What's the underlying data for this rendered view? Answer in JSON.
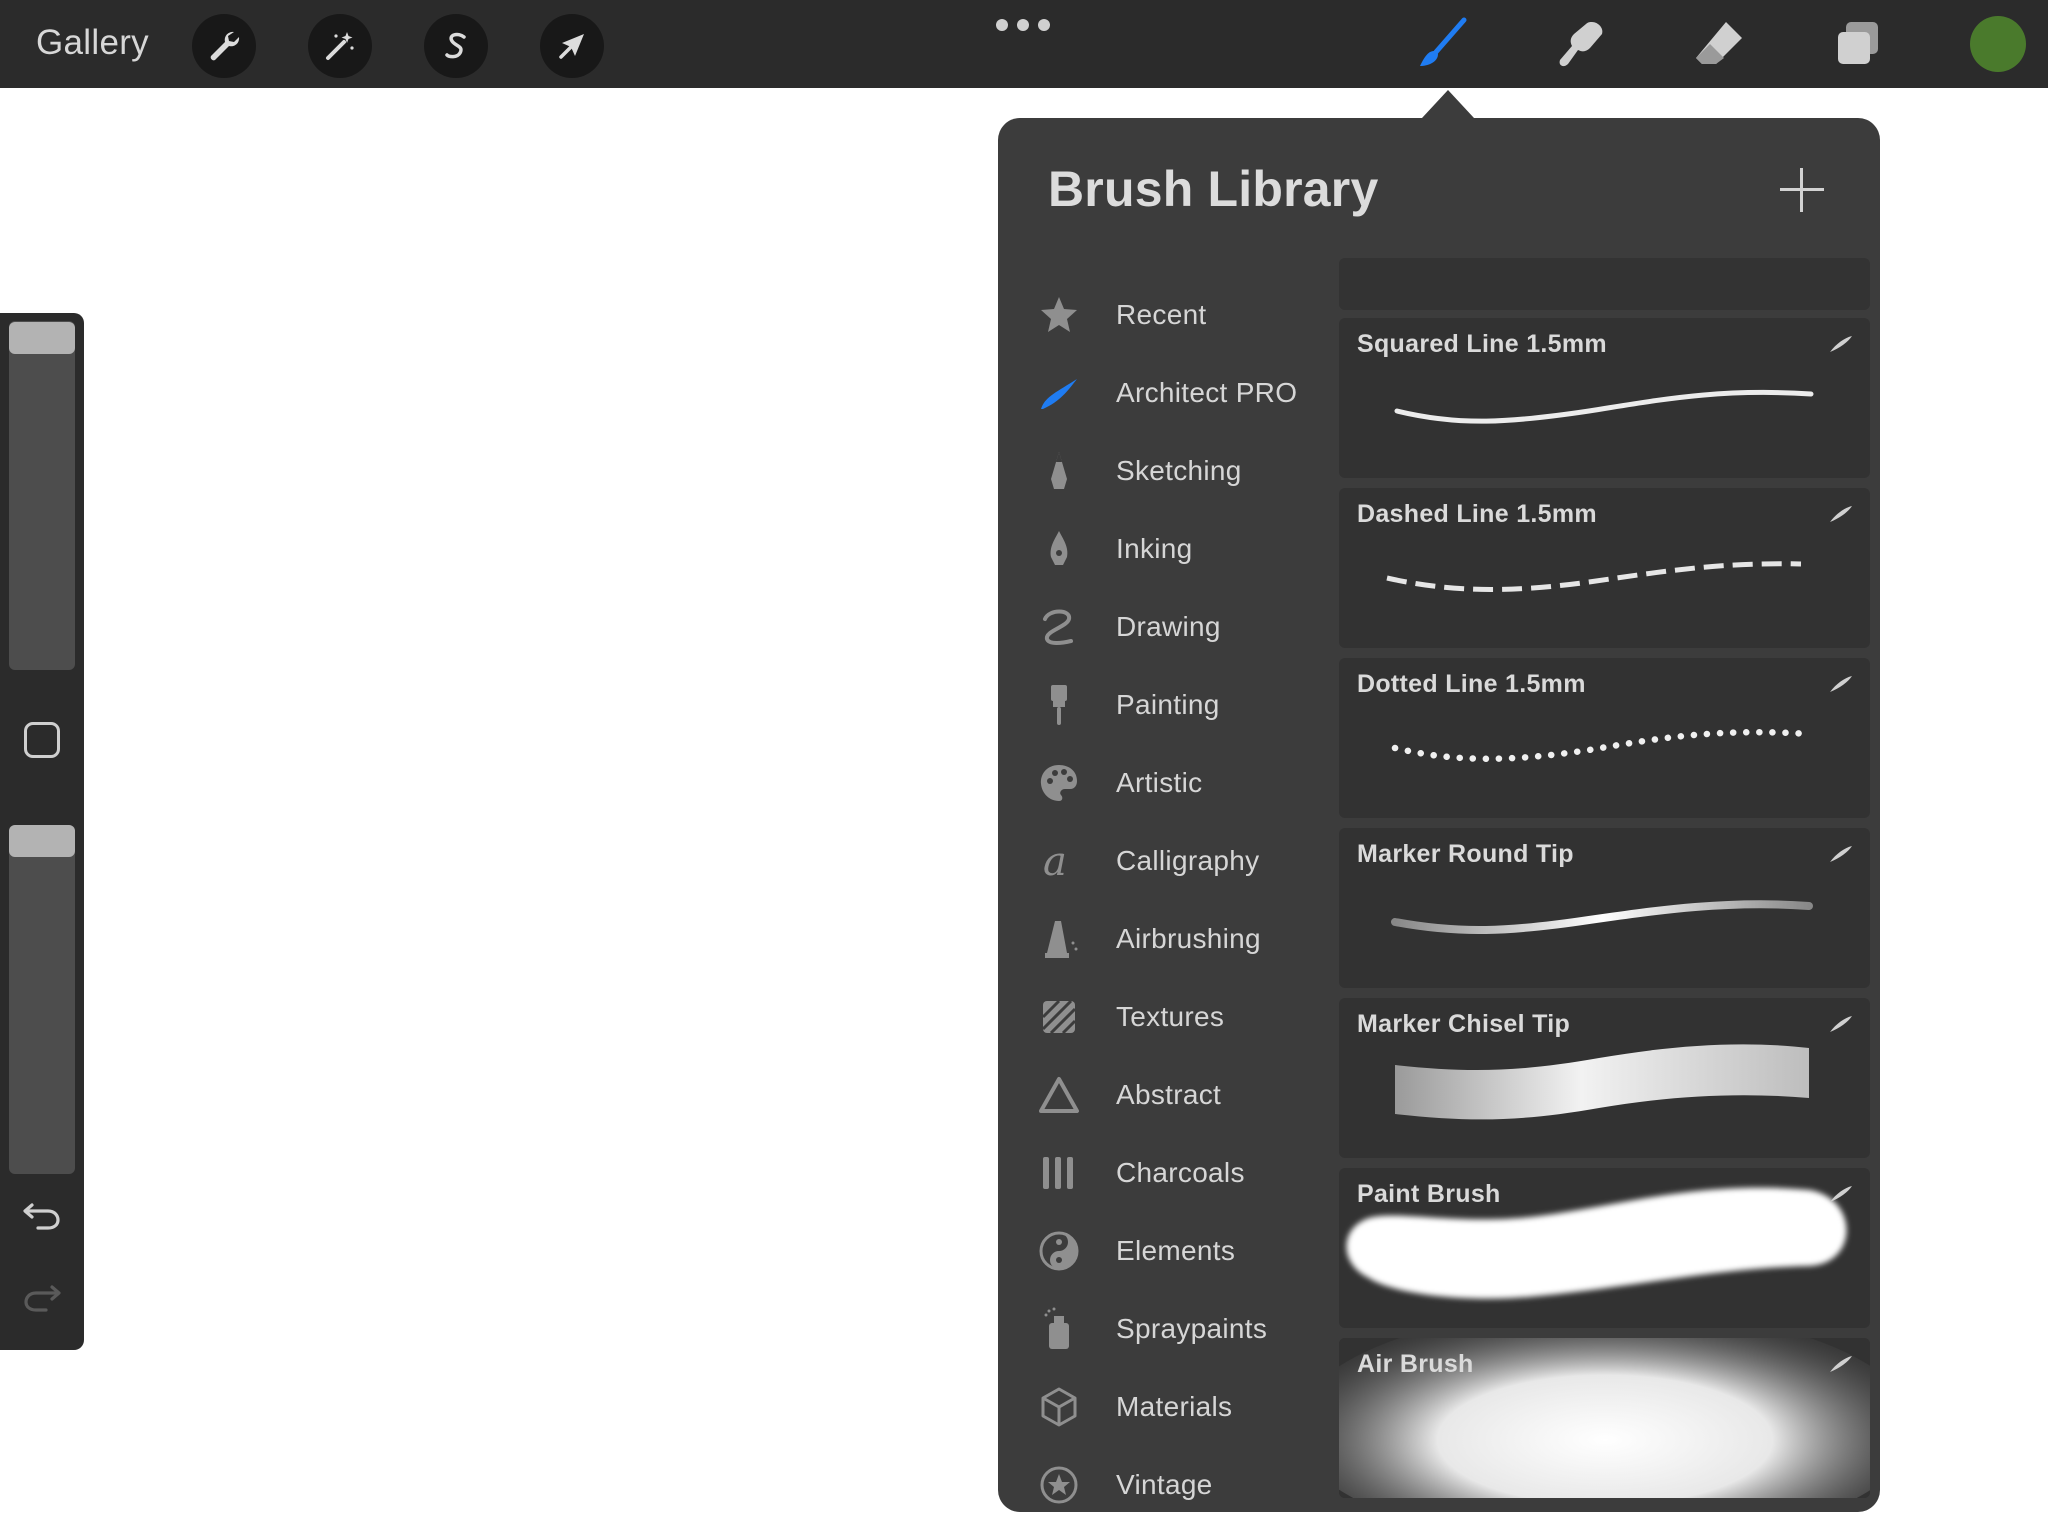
{
  "topbar": {
    "gallery_label": "Gallery",
    "left_tools": [
      {
        "name": "wrench-icon"
      },
      {
        "name": "magic-wand-icon"
      },
      {
        "name": "selection-icon"
      },
      {
        "name": "transform-arrow-icon"
      }
    ],
    "right_tools": [
      {
        "name": "brush-icon",
        "active": true,
        "color": "#1f7cf2"
      },
      {
        "name": "smudge-icon",
        "active": false
      },
      {
        "name": "eraser-icon",
        "active": false
      },
      {
        "name": "layers-icon",
        "active": false
      }
    ],
    "current_color": "#4a7a2c"
  },
  "brush_library": {
    "title": "Brush Library",
    "categories": [
      {
        "label": "Recent",
        "icon": "star-icon"
      },
      {
        "label": "Architect PRO",
        "icon": "brush-stroke-icon",
        "selected": true
      },
      {
        "label": "Sketching",
        "icon": "pencil-tip-icon"
      },
      {
        "label": "Inking",
        "icon": "ink-pen-icon"
      },
      {
        "label": "Drawing",
        "icon": "squiggle-icon"
      },
      {
        "label": "Painting",
        "icon": "paint-brush-icon"
      },
      {
        "label": "Artistic",
        "icon": "palette-icon"
      },
      {
        "label": "Calligraphy",
        "icon": "calligraphy-a-icon"
      },
      {
        "label": "Airbrushing",
        "icon": "airbrush-icon"
      },
      {
        "label": "Textures",
        "icon": "texture-icon"
      },
      {
        "label": "Abstract",
        "icon": "triangle-icon"
      },
      {
        "label": "Charcoals",
        "icon": "charcoal-icon"
      },
      {
        "label": "Elements",
        "icon": "yin-yang-icon"
      },
      {
        "label": "Spraypaints",
        "icon": "spray-can-icon"
      },
      {
        "label": "Materials",
        "icon": "cube-icon"
      },
      {
        "label": "Vintage",
        "icon": "star-badge-icon"
      }
    ],
    "brushes": [
      {
        "name": "Squared Line 1.5mm",
        "stroke": "solid"
      },
      {
        "name": "Dashed Line 1.5mm",
        "stroke": "dashed"
      },
      {
        "name": "Dotted Line 1.5mm",
        "stroke": "dotted"
      },
      {
        "name": "Marker Round Tip",
        "stroke": "marker-round"
      },
      {
        "name": "Marker Chisel Tip",
        "stroke": "marker-chisel"
      },
      {
        "name": "Paint Brush",
        "stroke": "paint"
      },
      {
        "name": "Air Brush",
        "stroke": "air"
      }
    ]
  }
}
